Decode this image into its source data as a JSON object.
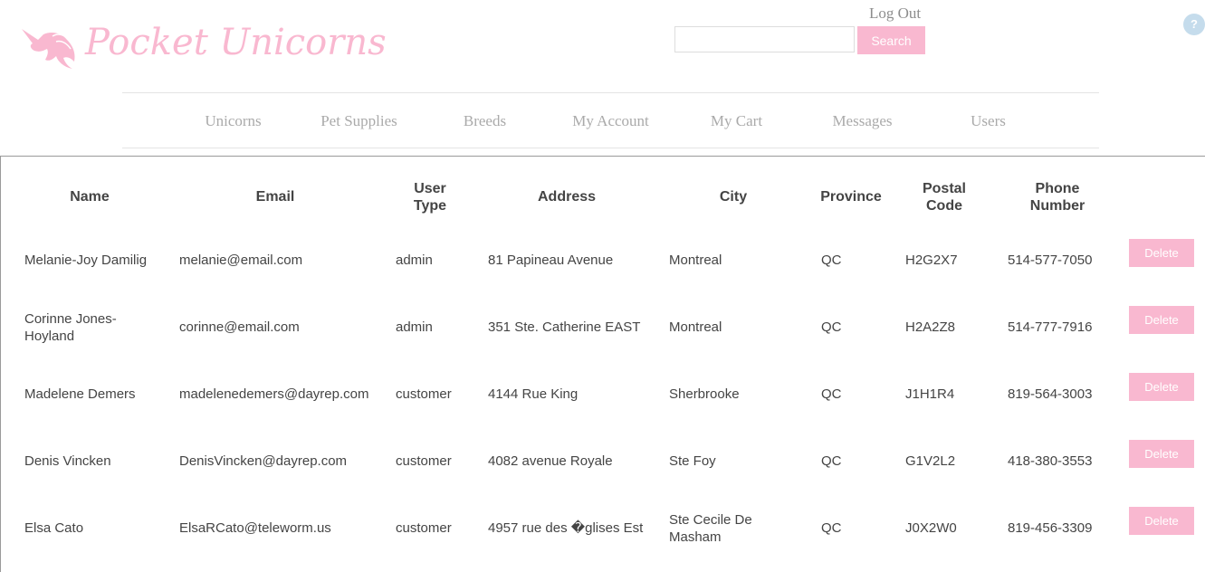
{
  "brand": {
    "name": "Pocket Unicorns",
    "color": "#f9b8d0"
  },
  "header": {
    "logout_label": "Log Out",
    "search_placeholder": "",
    "search_value": "",
    "search_label": "Search",
    "help_label": "?"
  },
  "nav": {
    "items": [
      "Unicorns",
      "Pet Supplies",
      "Breeds",
      "My Account",
      "My Cart",
      "Messages",
      "Users"
    ]
  },
  "table": {
    "headers": {
      "name": "Name",
      "email": "Email",
      "user_type": "User Type",
      "address": "Address",
      "city": "City",
      "province": "Province",
      "postal_code": "Postal Code",
      "phone": "Phone Number"
    },
    "delete_label": "Delete",
    "rows": [
      {
        "name": "Melanie-Joy Damilig",
        "email": "melanie@email.com",
        "user_type": "admin",
        "address": "81 Papineau Avenue",
        "city": "Montreal",
        "province": "QC",
        "postal_code": "H2G2X7",
        "phone": "514-577-7050"
      },
      {
        "name": "Corinne Jones-Hoyland",
        "email": "corinne@email.com",
        "user_type": "admin",
        "address": "351 Ste. Catherine EAST",
        "city": "Montreal",
        "province": "QC",
        "postal_code": "H2A2Z8",
        "phone": "514-777-7916"
      },
      {
        "name": "Madelene Demers",
        "email": "madelenedemers@dayrep.com",
        "user_type": "customer",
        "address": "4144 Rue King",
        "city": "Sherbrooke",
        "province": "QC",
        "postal_code": "J1H1R4",
        "phone": "819-564-3003"
      },
      {
        "name": "Denis Vincken",
        "email": "DenisVincken@dayrep.com",
        "user_type": "customer",
        "address": "4082 avenue Royale",
        "city": "Ste Foy",
        "province": "QC",
        "postal_code": "G1V2L2",
        "phone": "418-380-3553"
      },
      {
        "name": "Elsa Cato",
        "email": "ElsaRCato@teleworm.us",
        "user_type": "customer",
        "address": "4957 rue des �glises Est",
        "city": "Ste Cecile De Masham",
        "province": "QC",
        "postal_code": "J0X2W0",
        "phone": "819-456-3309"
      }
    ]
  }
}
